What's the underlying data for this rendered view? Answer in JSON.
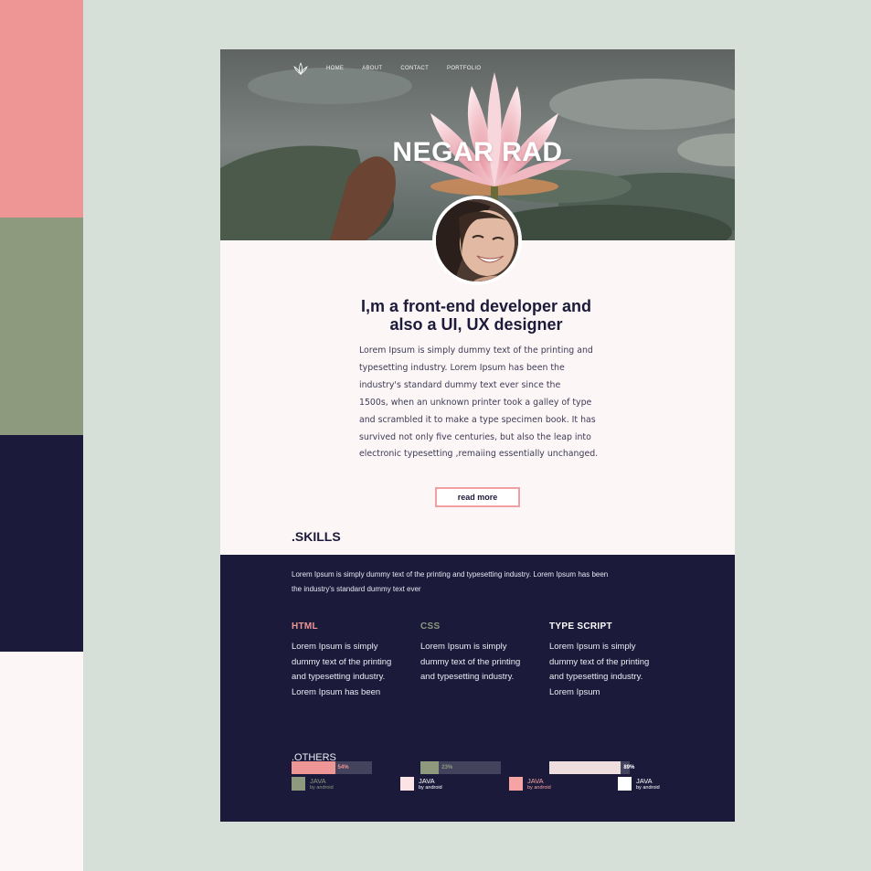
{
  "palette": [
    "#ee9595",
    "#8d9a7e",
    "#1b1a3a",
    "#fdf6f6"
  ],
  "nav": {
    "logo_icon": "lotus-icon",
    "items": [
      "HOME",
      "ABOUT",
      "CONTACT",
      "PORTFOLIO"
    ]
  },
  "hero": {
    "title": "NEGAR RAD"
  },
  "intro": {
    "title_line1": "I,m a front-end developer and",
    "title_line2": "also a UI, UX designer",
    "paragraph_lines": [
      "Lorem Ipsum is simply dummy text of the  printing and",
      "typesetting industry. Lorem Ipsum  has been the",
      "industry's standard dummy text ever  since the",
      "1500s, when an unknown printer took a galley of type",
      "and scrambled it  to make a type  specimen book. It has",
      "survived not only five centuries, but also the leap into",
      "electronic typesetting  ,remaiing essentially unchanged."
    ],
    "read_more_label": "read more"
  },
  "skills": {
    "heading": ".SKILLS",
    "intro_line1": "Lorem Ipsum is simply dummy text of the  printing and   typesetting industry. Lorem Ipsum  has been",
    "intro_line2": "the industry's standard dummy text ever",
    "items": [
      {
        "name": "HTML",
        "color": "#ee9595",
        "desc_lines": [
          "Lorem Ipsum is simply",
          "dummy text of the  printing",
          "and    typesetting industry.",
          "Lorem Ipsum  has been"
        ],
        "percent_label": "54%",
        "percent": 54
      },
      {
        "name": "CSS",
        "color": "#8d9a7e",
        "desc_lines": [
          "Lorem Ipsum is simply",
          "dummy text of the  printing",
          "and    typesetting industry."
        ],
        "percent_label": "23%",
        "percent": 23
      },
      {
        "name": "TYPE SCRIPT",
        "color": "#ffffff",
        "desc_lines": [
          "Lorem Ipsum is simply",
          "dummy text of the  printing",
          "and    typesetting industry.",
          "Lorem Ipsum"
        ],
        "percent_label": "89%",
        "percent": 89
      }
    ]
  },
  "others": {
    "heading": ".OTHERS",
    "items": [
      {
        "title": "JAVA",
        "subtitle": "by android",
        "color": "#8d9a7e"
      },
      {
        "title": "JAVA",
        "subtitle": "by android",
        "color": "#fde4e4"
      },
      {
        "title": "JAVA",
        "subtitle": "by android",
        "color": "#f5a3a3"
      },
      {
        "title": "JAVA",
        "subtitle": "by android",
        "color": "#ffffff"
      }
    ]
  }
}
